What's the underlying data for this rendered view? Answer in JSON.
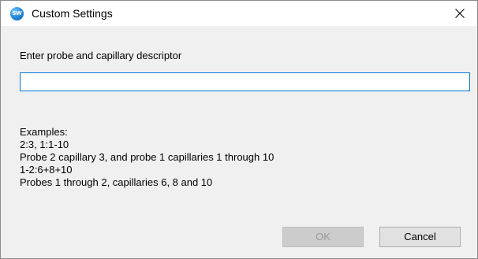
{
  "window": {
    "title": "Custom Settings",
    "icon": "app-logo-icon",
    "icon_text": "SW",
    "close_glyph": "close-icon"
  },
  "form": {
    "prompt": "Enter probe and capillary descriptor",
    "input_value": "",
    "input_placeholder": ""
  },
  "examples": {
    "heading": "Examples:",
    "lines": [
      "2:3, 1:1-10",
      "Probe 2 capillary 3, and probe 1 capillaries 1 through 10",
      "1-2:6+8+10",
      "Probes 1 through 2, capillaries 6, 8 and 10"
    ]
  },
  "buttons": {
    "ok_label": "OK",
    "ok_enabled": false,
    "cancel_label": "Cancel"
  },
  "colors": {
    "input_border_focus": "#0078d7",
    "dialog_background": "#f0f0f0",
    "titlebar_background": "#ffffff"
  }
}
